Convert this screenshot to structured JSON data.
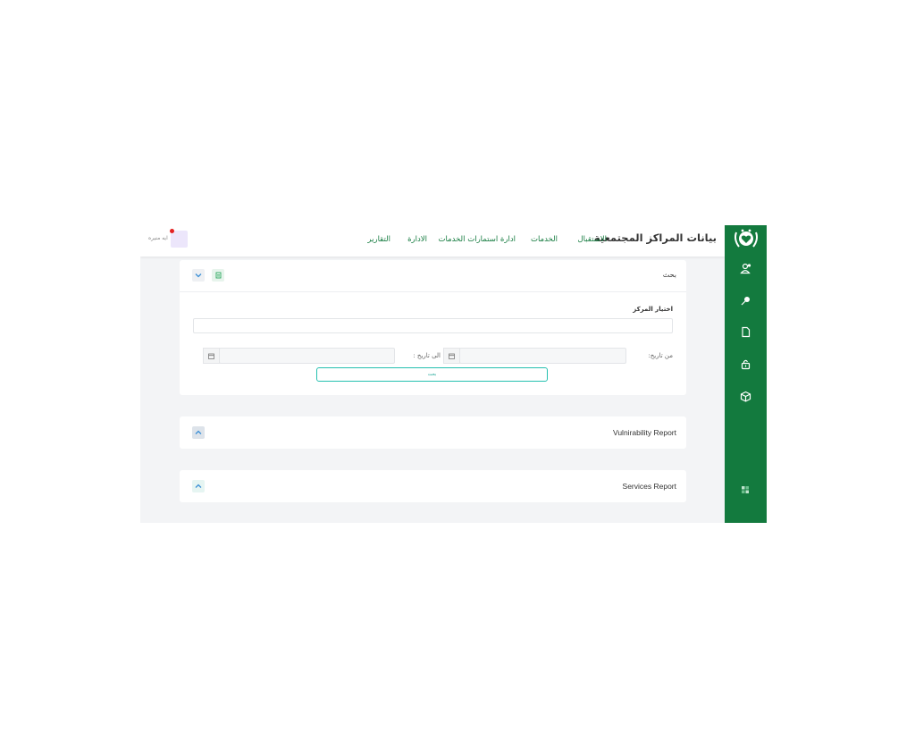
{
  "brand": {
    "title": "بيانات المراكز المجتمعية"
  },
  "nav": {
    "items": [
      "الاستقبال",
      "الخدمات",
      "ادارة استمارات الخدمات",
      "الادارة",
      "التقارير"
    ]
  },
  "user": {
    "name": "ايه منيره"
  },
  "sidebar": {
    "icons": [
      "logo-emblem",
      "add-user-icon",
      "search-icon",
      "file-icon",
      "lock-icon",
      "box-icon",
      "grid-icon"
    ]
  },
  "search_card": {
    "title": "بحث",
    "center_label": "اختيار المركز",
    "from_label": "من تاريخ:",
    "to_label": "الى تاريخ :",
    "search_button": "بحث",
    "center_value": "",
    "from_value": "",
    "to_value": ""
  },
  "reports": [
    {
      "title": "Vulnirability Report"
    },
    {
      "title": "Services Report"
    }
  ],
  "colors": {
    "sidebar": "#137a3e",
    "accent": "#25c0b0",
    "nav_text": "#137a3e",
    "notification": "#e32222"
  }
}
